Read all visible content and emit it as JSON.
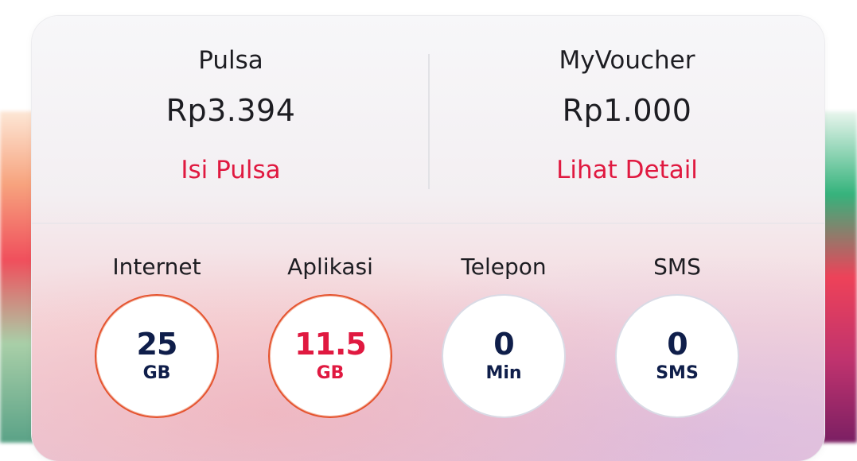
{
  "balances": {
    "pulsa": {
      "label": "Pulsa",
      "value": "Rp3.394",
      "link": "Isi Pulsa"
    },
    "voucher": {
      "label": "MyVoucher",
      "value": "Rp1.000",
      "link": "Lihat Detail"
    }
  },
  "quotas": [
    {
      "label": "Internet",
      "value": "25",
      "unit": "GB"
    },
    {
      "label": "Aplikasi",
      "value": "11.5",
      "unit": "GB"
    },
    {
      "label": "Telepon",
      "value": "0",
      "unit": "Min"
    },
    {
      "label": "SMS",
      "value": "0",
      "unit": "SMS"
    }
  ],
  "colors": {
    "accent": "#e01940",
    "value_text": "#0f1e4a",
    "ring_active": "#e5532e"
  }
}
